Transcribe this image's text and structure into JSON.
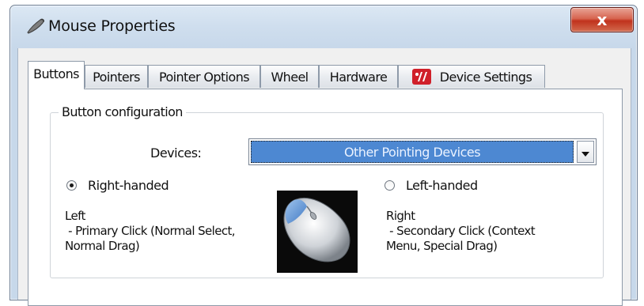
{
  "window": {
    "title": "Mouse Properties",
    "close_label": "x"
  },
  "tabs": [
    {
      "label": "Buttons",
      "active": true
    },
    {
      "label": "Pointers",
      "active": false
    },
    {
      "label": "Pointer Options",
      "active": false
    },
    {
      "label": "Wheel",
      "active": false
    },
    {
      "label": "Hardware",
      "active": false
    },
    {
      "label": "Device Settings",
      "active": false,
      "icon": "device-settings-icon"
    }
  ],
  "button_configuration": {
    "group_label": "Button configuration",
    "devices_label": "Devices:",
    "devices_selected": "Other Pointing Devices",
    "right_handed": {
      "label": "Right-handed",
      "checked": true,
      "desc_title": "Left",
      "desc_line1": " - Primary Click (Normal Select,",
      "desc_line2": "Normal Drag)"
    },
    "left_handed": {
      "label": "Left-handed",
      "checked": false,
      "desc_title": "Right",
      "desc_line1": " - Secondary Click (Context",
      "desc_line2": "Menu, Special Drag)"
    }
  },
  "colors": {
    "selection_blue": "#4d88d2",
    "close_red": "#c0321c",
    "device_settings_red": "#d0202a"
  }
}
